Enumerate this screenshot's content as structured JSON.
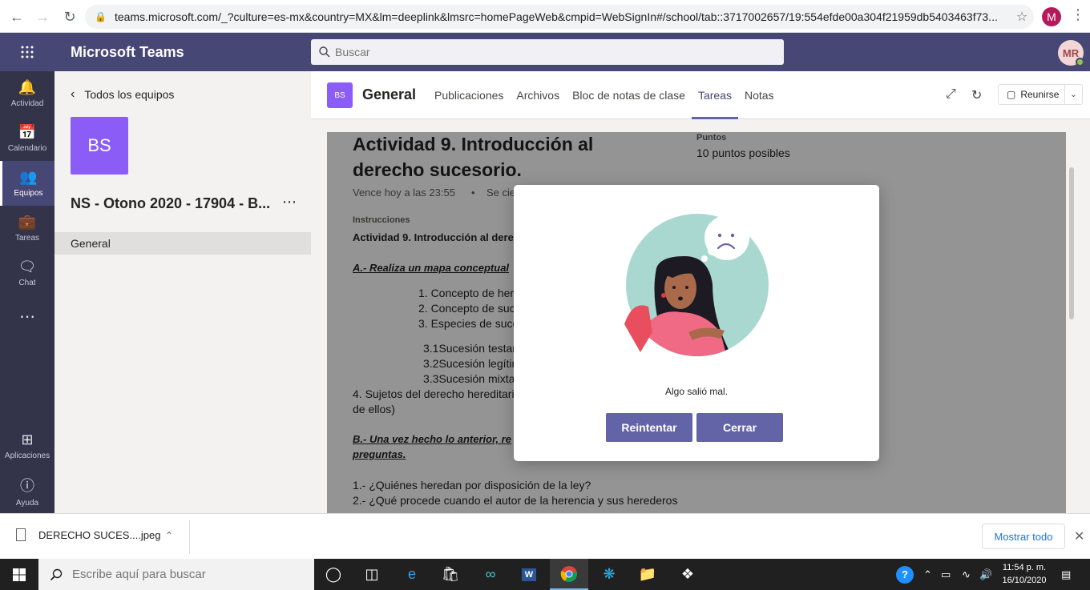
{
  "browser": {
    "url": "teams.microsoft.com/_?culture=es-mx&country=MX&lm=deeplink&lmsrc=homePageWeb&cmpid=WebSignIn#/school/tab::3717002657/19:554efde00a304f21959db5403463f73...",
    "profile_initial": "M"
  },
  "header": {
    "app_title": "Microsoft Teams",
    "search_placeholder": "Buscar",
    "avatar_initials": "MR"
  },
  "rail": {
    "items": [
      {
        "label": "Actividad",
        "icon": "bell-icon"
      },
      {
        "label": "Calendario",
        "icon": "calendar-icon"
      },
      {
        "label": "Equipos",
        "icon": "teams-icon"
      },
      {
        "label": "Tareas",
        "icon": "assignments-icon"
      },
      {
        "label": "Chat",
        "icon": "chat-icon"
      },
      {
        "label": "Aplicaciones",
        "icon": "apps-icon"
      },
      {
        "label": "Ayuda",
        "icon": "help-icon"
      }
    ]
  },
  "side": {
    "back_label": "Todos los equipos",
    "team_tile": "BS",
    "team_name": "NS - Otono 2020 - 17904 - B...",
    "channel": "General"
  },
  "channel": {
    "badge": "BS",
    "title": "General",
    "tabs": [
      "Publicaciones",
      "Archivos",
      "Bloc de notas de clase",
      "Tareas",
      "Notas"
    ],
    "active_tab": "Tareas",
    "meet_label": "Reunirse"
  },
  "assignment": {
    "title_line1": "Actividad 9. Introducción al",
    "title_line2": "derecho sucesorio.",
    "due": "Vence hoy a las 23:55",
    "closes": "Se cie",
    "points_label": "Puntos",
    "points_value": "10 puntos posibles",
    "instructions_label": "Instrucciones",
    "instructions_title": "Actividad 9. Introducción al dere",
    "section_a": "A.- Realiza un mapa conceptual",
    "list": [
      "1. Concepto de here",
      "2. Concepto de suc",
      "3. Especies de suces"
    ],
    "sublist": [
      "3.1Sucesión testan",
      "3.2Sucesión legítin",
      "3.3Sucesión mixta"
    ],
    "item4_line1": "4. Sujetos del derecho hereditari",
    "item4_line2": "de ellos)",
    "section_b_line1": "B.- Una vez hecho lo anterior, re",
    "section_b_line2": "preguntas.",
    "q1": "1.- ¿Quiénes heredan por disposición de la ley?",
    "q2": "2.- ¿Qué procede cuando el autor de la herencia y sus herederos"
  },
  "dialog": {
    "message": "Algo salió mal.",
    "retry_label": "Reintentar",
    "close_label": "Cerrar"
  },
  "downloads": {
    "file_name": "DERECHO SUCES....jpeg",
    "show_all": "Mostrar todo"
  },
  "taskbar": {
    "search_placeholder": "Escribe aquí para buscar",
    "time": "11:54 p. m.",
    "date": "16/10/2020"
  },
  "colors": {
    "teams_purple": "#464775",
    "accent": "#6264a7",
    "rail": "#33344a",
    "team_tile": "#8b5cf6"
  }
}
